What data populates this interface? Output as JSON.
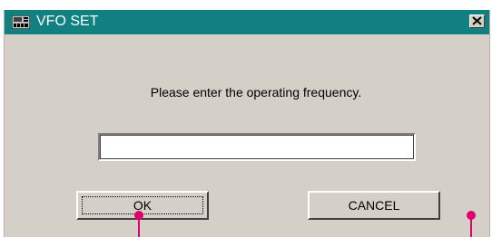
{
  "window": {
    "title": "VFO SET",
    "close_label": "✕"
  },
  "dialog": {
    "prompt": "Please enter the operating frequency.",
    "frequency_value": ""
  },
  "buttons": {
    "ok_label": "OK",
    "cancel_label": "CANCEL"
  },
  "colors": {
    "titlebar": "#108080",
    "dialog_bg": "#d4d0c8",
    "callout_marker": "#e0006e"
  }
}
